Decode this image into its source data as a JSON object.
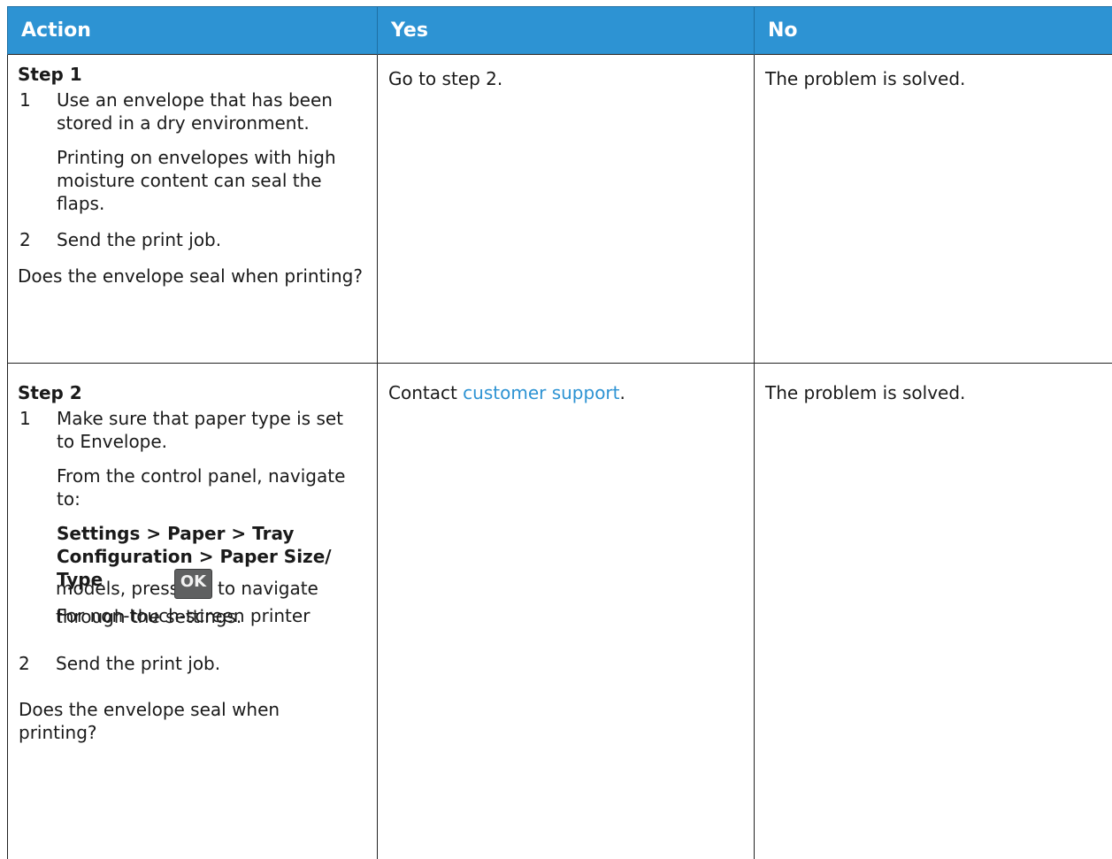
{
  "header": {
    "action": "Action",
    "yes": "Yes",
    "no": "No"
  },
  "step1": {
    "title": "Step 1",
    "item1_num": "1",
    "item1_text": "Use an envelope that has been stored in a dry environment.",
    "item1_note": "Printing on envelopes with high moisture content can seal the flaps.",
    "item2_num": "2",
    "item2_text": "Send the print job.",
    "question": "Does the envelope seal when printing?",
    "yes": "Go to step 2.",
    "no": "The problem is solved."
  },
  "step2": {
    "title": "Step 2",
    "item1_num": "1",
    "item1_text": "Make sure that paper type is set to Envelope.",
    "nav_intro": "From the control panel, navigate to:",
    "nav_path": "Settings > Paper > Tray Configuration > Paper Size/ Type",
    "nontouch_before": "For non-touch-screen printer models, press",
    "ok_key": "OK",
    "nontouch_after": "to navigate through the settings.",
    "item2_num": "2",
    "item2_text": "Send the print job.",
    "question": "Does the envelope seal when printing?",
    "yes_before": "Contact",
    "yes_link": "customer support",
    "yes_after": ".",
    "no": "The problem is solved."
  },
  "colors": {
    "header_bg": "#2d93d3",
    "link": "#2d93d3"
  }
}
